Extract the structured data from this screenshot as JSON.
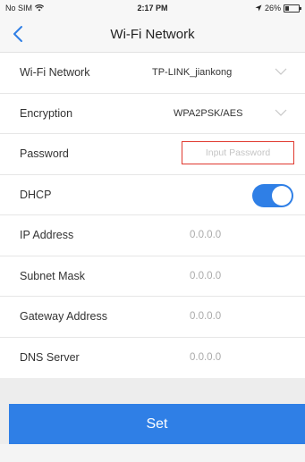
{
  "status_bar": {
    "carrier": "No SIM",
    "time": "2:17 PM",
    "battery": "26%",
    "battery_level": 0.26
  },
  "nav": {
    "title": "Wi-Fi Network",
    "back_icon": "chevron-left-icon"
  },
  "form": {
    "wifi_network": {
      "label": "Wi-Fi Network",
      "value": "TP-LINK_jiankong"
    },
    "encryption": {
      "label": "Encryption",
      "value": "WPA2PSK/AES"
    },
    "password": {
      "label": "Password",
      "placeholder": "Input Password",
      "value": ""
    },
    "dhcp": {
      "label": "DHCP",
      "enabled": true
    },
    "ip_address": {
      "label": "IP Address",
      "value": "0.0.0.0"
    },
    "subnet_mask": {
      "label": "Subnet Mask",
      "value": "0.0.0.0"
    },
    "gateway_address": {
      "label": "Gateway Address",
      "value": "0.0.0.0"
    },
    "dns_server": {
      "label": "DNS Server",
      "value": "0.0.0.0"
    }
  },
  "actions": {
    "set_label": "Set"
  },
  "colors": {
    "accent": "#2f7fe6",
    "error_border": "#e0392f"
  }
}
